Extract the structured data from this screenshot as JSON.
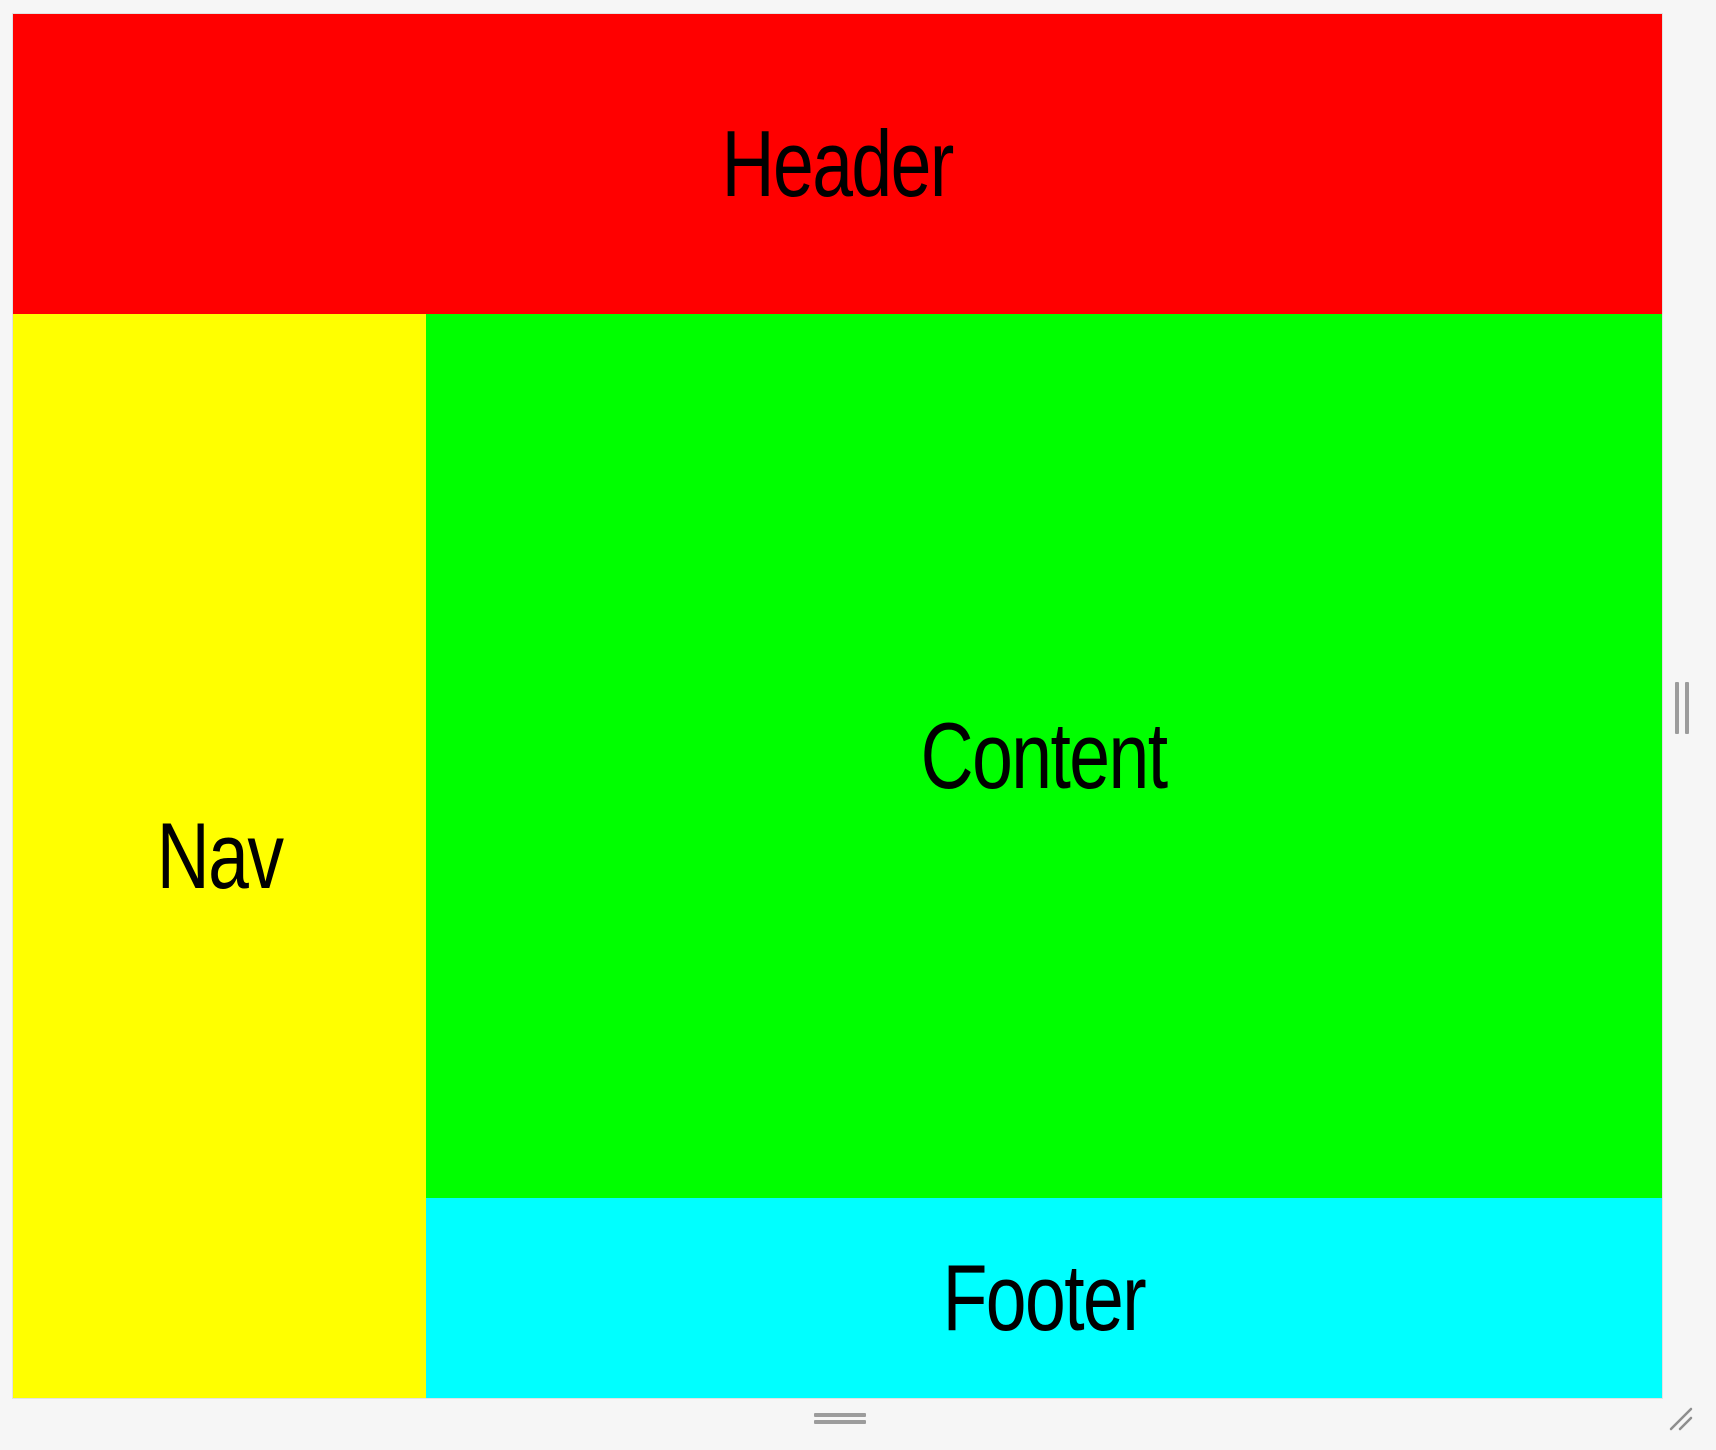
{
  "colors": {
    "header": "#ff0000",
    "nav": "#ffff00",
    "content": "#00ff00",
    "footer": "#00ffff"
  },
  "regions": {
    "header": "Header",
    "nav": "Nav",
    "content": "Content",
    "footer": "Footer"
  },
  "controls": {
    "right_handle_icon": "vertical-drag-handle-icon",
    "bottom_handle_icon": "horizontal-drag-handle-icon",
    "resize_icon": "resize-grip-icon"
  }
}
